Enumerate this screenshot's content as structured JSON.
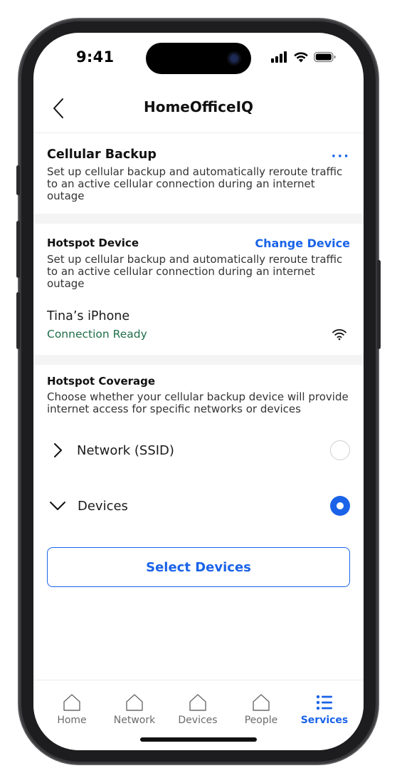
{
  "status_bar": {
    "time": "9:41"
  },
  "header": {
    "title": "HomeOfficeIQ"
  },
  "cellular_backup": {
    "title": "Cellular Backup",
    "more_label": "···",
    "description": "Set up cellular backup and automatically reroute traffic to an active cellular connection during an internet outage"
  },
  "hotspot_device": {
    "title": "Hotspot Device",
    "change_label": "Change Device",
    "description": "Set up cellular backup and automatically reroute traffic to an active cellular connection during an internet outage",
    "device_name": "Tina’s iPhone",
    "device_status": "Connection Ready"
  },
  "hotspot_coverage": {
    "title": "Hotspot Coverage",
    "description": "Choose whether your cellular backup device will provide internet access for specific networks or devices",
    "options": [
      {
        "label": "Network (SSID)",
        "expanded": false,
        "selected": false
      },
      {
        "label": "Devices",
        "expanded": true,
        "selected": true
      }
    ],
    "select_button_label": "Select Devices"
  },
  "tabbar": {
    "tabs": [
      {
        "label": "Home",
        "icon": "home-icon",
        "active": false
      },
      {
        "label": "Network",
        "icon": "home-icon",
        "active": false
      },
      {
        "label": "Devices",
        "icon": "home-icon",
        "active": false
      },
      {
        "label": "People",
        "icon": "home-icon",
        "active": false
      },
      {
        "label": "Services",
        "icon": "list-icon",
        "active": true
      }
    ]
  },
  "colors": {
    "accent": "#1a63e8",
    "success": "#1f6e4a",
    "divider": "#ececec"
  }
}
